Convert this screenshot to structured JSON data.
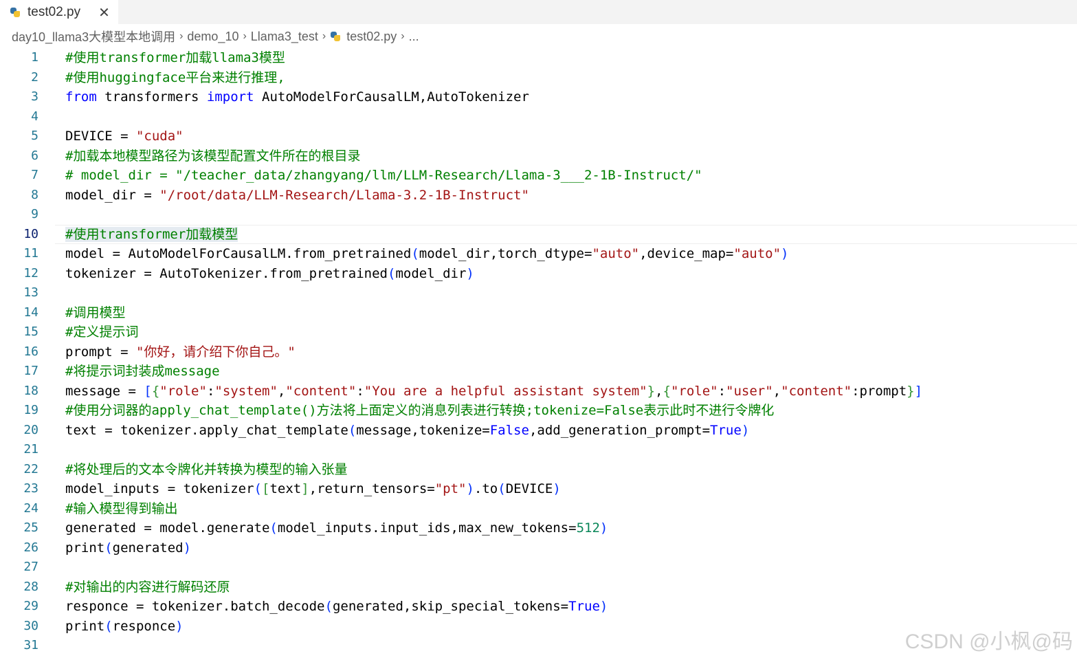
{
  "tab": {
    "title": "test02.py",
    "close_glyph": "✕",
    "icon": "python-file-icon"
  },
  "breadcrumb": {
    "items": [
      "day10_llama3大模型本地调用",
      "demo_10",
      "Llama3_test",
      "test02.py",
      "..."
    ],
    "separator": "›"
  },
  "editor": {
    "current_line": 10,
    "lines": [
      {
        "num": "1",
        "tokens": [
          {
            "t": "#使用transformer加载llama3模型",
            "c": "comment"
          }
        ]
      },
      {
        "num": "2",
        "tokens": [
          {
            "t": "#使用huggingface平台来进行推理,",
            "c": "comment"
          }
        ]
      },
      {
        "num": "3",
        "tokens": [
          {
            "t": "from",
            "c": "keyword"
          },
          {
            "t": " transformers ",
            "c": "default"
          },
          {
            "t": "import",
            "c": "keyword"
          },
          {
            "t": " AutoModelForCausalLM,AutoTokenizer",
            "c": "default"
          }
        ]
      },
      {
        "num": "4",
        "tokens": []
      },
      {
        "num": "5",
        "tokens": [
          {
            "t": "DEVICE = ",
            "c": "default"
          },
          {
            "t": "\"cuda\"",
            "c": "string"
          }
        ]
      },
      {
        "num": "6",
        "tokens": [
          {
            "t": "#加载本地模型路径为该模型配置文件所在的根目录",
            "c": "comment"
          }
        ]
      },
      {
        "num": "7",
        "tokens": [
          {
            "t": "# model_dir = \"/teacher_data/zhangyang/llm/LLM-Research/Llama-3___2-1B-Instruct/\"",
            "c": "comment"
          }
        ]
      },
      {
        "num": "8",
        "tokens": [
          {
            "t": "model_dir = ",
            "c": "default"
          },
          {
            "t": "\"/root/data/LLM-Research/Llama-3.2-1B-Instruct\"",
            "c": "string"
          }
        ]
      },
      {
        "num": "9",
        "tokens": []
      },
      {
        "num": "10",
        "tokens": [
          {
            "t": "#使用transformer加载模型",
            "c": "comment",
            "hl": true
          }
        ]
      },
      {
        "num": "11",
        "tokens": [
          {
            "t": "model = AutoModelForCausalLM.from_pretrained",
            "c": "default"
          },
          {
            "t": "(",
            "c": "paren"
          },
          {
            "t": "model_dir,torch_dtype=",
            "c": "default"
          },
          {
            "t": "\"auto\"",
            "c": "string"
          },
          {
            "t": ",device_map=",
            "c": "default"
          },
          {
            "t": "\"auto\"",
            "c": "string"
          },
          {
            "t": ")",
            "c": "paren"
          }
        ]
      },
      {
        "num": "12",
        "tokens": [
          {
            "t": "tokenizer = AutoTokenizer.from_pretrained",
            "c": "default"
          },
          {
            "t": "(",
            "c": "paren"
          },
          {
            "t": "model_dir",
            "c": "default"
          },
          {
            "t": ")",
            "c": "paren"
          }
        ]
      },
      {
        "num": "13",
        "tokens": []
      },
      {
        "num": "14",
        "tokens": [
          {
            "t": "#调用模型",
            "c": "comment"
          }
        ]
      },
      {
        "num": "15",
        "tokens": [
          {
            "t": "#定义提示词",
            "c": "comment"
          }
        ]
      },
      {
        "num": "16",
        "tokens": [
          {
            "t": "prompt = ",
            "c": "default"
          },
          {
            "t": "\"你好，请介绍下你自己。\"",
            "c": "string"
          }
        ]
      },
      {
        "num": "17",
        "tokens": [
          {
            "t": "#将提示词封装成message",
            "c": "comment"
          }
        ]
      },
      {
        "num": "18",
        "tokens": [
          {
            "t": "message = ",
            "c": "default"
          },
          {
            "t": "[",
            "c": "bracket"
          },
          {
            "t": "{",
            "c": "brace"
          },
          {
            "t": "\"role\"",
            "c": "string"
          },
          {
            "t": ":",
            "c": "default"
          },
          {
            "t": "\"system\"",
            "c": "string"
          },
          {
            "t": ",",
            "c": "default"
          },
          {
            "t": "\"content\"",
            "c": "string"
          },
          {
            "t": ":",
            "c": "default"
          },
          {
            "t": "\"You are a helpful assistant system\"",
            "c": "string"
          },
          {
            "t": "}",
            "c": "brace"
          },
          {
            "t": ",",
            "c": "default"
          },
          {
            "t": "{",
            "c": "brace"
          },
          {
            "t": "\"role\"",
            "c": "string"
          },
          {
            "t": ":",
            "c": "default"
          },
          {
            "t": "\"user\"",
            "c": "string"
          },
          {
            "t": ",",
            "c": "default"
          },
          {
            "t": "\"content\"",
            "c": "string"
          },
          {
            "t": ":prompt",
            "c": "default"
          },
          {
            "t": "}",
            "c": "brace"
          },
          {
            "t": "]",
            "c": "bracket"
          }
        ]
      },
      {
        "num": "19",
        "tokens": [
          {
            "t": "#使用分词器的apply_chat_template()方法将上面定义的消息列表进行转换;tokenize=False表示此时不进行令牌化",
            "c": "comment"
          }
        ]
      },
      {
        "num": "20",
        "tokens": [
          {
            "t": "text = tokenizer.apply_chat_template",
            "c": "default"
          },
          {
            "t": "(",
            "c": "paren"
          },
          {
            "t": "message,tokenize=",
            "c": "default"
          },
          {
            "t": "False",
            "c": "bool"
          },
          {
            "t": ",add_generation_prompt=",
            "c": "default"
          },
          {
            "t": "True",
            "c": "bool"
          },
          {
            "t": ")",
            "c": "paren"
          }
        ]
      },
      {
        "num": "21",
        "tokens": []
      },
      {
        "num": "22",
        "tokens": [
          {
            "t": "#将处理后的文本令牌化并转换为模型的输入张量",
            "c": "comment"
          }
        ]
      },
      {
        "num": "23",
        "tokens": [
          {
            "t": "model_inputs = tokenizer",
            "c": "default"
          },
          {
            "t": "(",
            "c": "paren"
          },
          {
            "t": "[",
            "c": "brace"
          },
          {
            "t": "text",
            "c": "default"
          },
          {
            "t": "]",
            "c": "brace"
          },
          {
            "t": ",return_tensors=",
            "c": "default"
          },
          {
            "t": "\"pt\"",
            "c": "string"
          },
          {
            "t": ")",
            "c": "paren"
          },
          {
            "t": ".to",
            "c": "default"
          },
          {
            "t": "(",
            "c": "paren"
          },
          {
            "t": "DEVICE",
            "c": "default"
          },
          {
            "t": ")",
            "c": "paren"
          }
        ]
      },
      {
        "num": "24",
        "tokens": [
          {
            "t": "#输入模型得到输出",
            "c": "comment"
          }
        ]
      },
      {
        "num": "25",
        "tokens": [
          {
            "t": "generated = model.generate",
            "c": "default"
          },
          {
            "t": "(",
            "c": "paren"
          },
          {
            "t": "model_inputs.input_ids,max_new_tokens=",
            "c": "default"
          },
          {
            "t": "512",
            "c": "number"
          },
          {
            "t": ")",
            "c": "paren"
          }
        ]
      },
      {
        "num": "26",
        "tokens": [
          {
            "t": "print",
            "c": "default"
          },
          {
            "t": "(",
            "c": "paren"
          },
          {
            "t": "generated",
            "c": "default"
          },
          {
            "t": ")",
            "c": "paren"
          }
        ]
      },
      {
        "num": "27",
        "tokens": []
      },
      {
        "num": "28",
        "tokens": [
          {
            "t": "#对输出的内容进行解码还原",
            "c": "comment"
          }
        ]
      },
      {
        "num": "29",
        "tokens": [
          {
            "t": "responce = tokenizer.batch_decode",
            "c": "default"
          },
          {
            "t": "(",
            "c": "paren"
          },
          {
            "t": "generated,skip_special_tokens=",
            "c": "default"
          },
          {
            "t": "True",
            "c": "bool"
          },
          {
            "t": ")",
            "c": "paren"
          }
        ]
      },
      {
        "num": "30",
        "tokens": [
          {
            "t": "print",
            "c": "default"
          },
          {
            "t": "(",
            "c": "paren"
          },
          {
            "t": "responce",
            "c": "default"
          },
          {
            "t": ")",
            "c": "paren"
          }
        ]
      },
      {
        "num": "31",
        "tokens": []
      }
    ]
  },
  "watermark": "CSDN @小枫@码",
  "colors": {
    "comment": "#008000",
    "keyword": "#0000ff",
    "string": "#a31515",
    "number": "#098658",
    "line_number": "#237893",
    "current_line_number": "#0b216f"
  }
}
